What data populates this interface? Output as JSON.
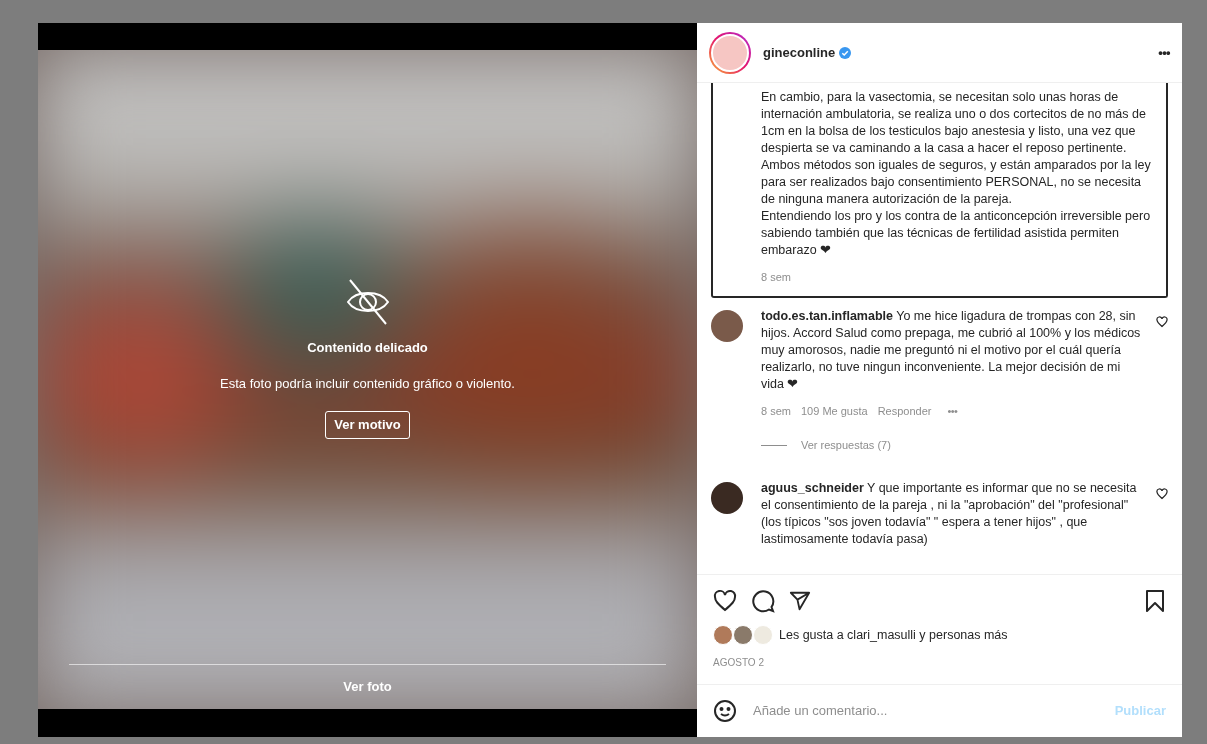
{
  "photo": {
    "title": "Contenido delicado",
    "description": "Esta foto podría incluir contenido gráfico o violento.",
    "reason_button": "Ver motivo",
    "view_button": "Ver foto"
  },
  "post": {
    "username": "gineconline",
    "verified": true,
    "more": "•••",
    "caption": {
      "lines": [
        "En cambio, para la vasectomia, se necesitan solo unas horas de internación ambulatoria, se realiza uno o dos cortecitos de no más de 1cm en la bolsa de los testiculos bajo anestesia y listo, una vez que despierta se va caminando a la casa a hacer el reposo pertinente.",
        "Ambos métodos son iguales de seguros, y están amparados por la ley para ser realizados bajo consentimiento PERSONAL, no se necesita de ninguna manera autorización de la pareja.",
        "Entendiendo los pro y los contra de la anticoncepción irreversible pero sabiendo también que las técnicas de fertilidad asistida permiten embarazo ❤"
      ],
      "time": "8 sem"
    },
    "comments": [
      {
        "username": "todo.es.tan.inflamable",
        "text": "Yo me hice ligadura de trompas con 28, sin hijos. Accord Salud como prepaga, me cubrió al 100% y los médicos muy amorosos, nadie me preguntó ni el motivo por el cuál quería realizarlo, no tuve ningun inconveniente. La mejor decisión de mi vida ❤",
        "time": "8 sem",
        "likes": "109 Me gusta",
        "reply": "Responder",
        "more": "•••",
        "replies": "Ver respuestas (7)"
      },
      {
        "username": "aguus_schneider",
        "text": "Y que importante es informar que no se necesita el consentimiento de la pareja , ni la \"aprobación\" del \"profesional\" (los típicos \"sos joven todavía\" \" espera a tener hijos\" , que lastimosamente todavía pasa)"
      }
    ],
    "likes_text": "Les gusta a clari_masulli y personas más",
    "date": "AGOSTO 2",
    "comment_field": {
      "placeholder": "Añade un comentario...",
      "submit": "Publicar"
    }
  }
}
